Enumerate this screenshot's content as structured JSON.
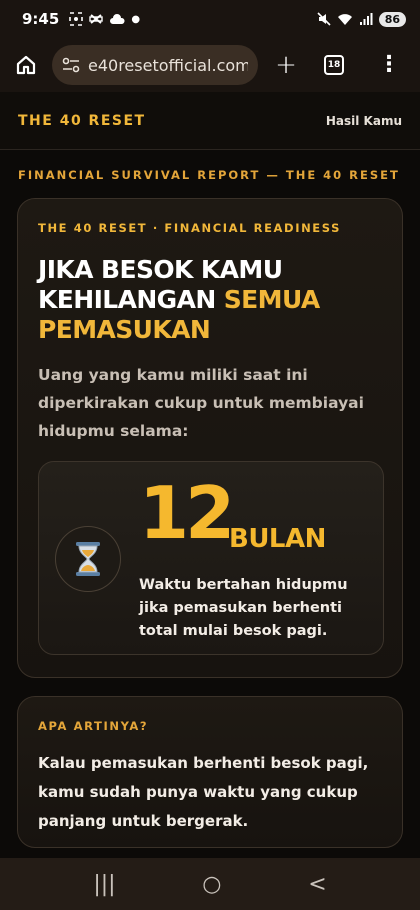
{
  "status_bar": {
    "time": "9:45",
    "battery": "86"
  },
  "browser": {
    "url": "e40resetofficial.com",
    "tab_count": "18",
    "plus": "+",
    "menu": "⋮"
  },
  "site_header": {
    "brand": "THE 40 RESET",
    "link": "Hasil Kamu"
  },
  "eyebrow": "FINANCIAL SURVIVAL REPORT — THE 40 RESET",
  "main_card": {
    "label": "THE 40 RESET · FINANCIAL READINESS",
    "headline_part1": "Jika besok kamu kehilangan",
    "headline_accent": "semua pemasukan",
    "intro": "Uang yang kamu miliki saat ini diperkirakan cukup untuk membiayai hidupmu selama:",
    "months_value": "12",
    "months_unit": "BULAN",
    "duration_desc": "Waktu bertahan hidupmu jika pemasukan berhenti total mulai besok pagi."
  },
  "meaning_card": {
    "label": "APA ARTINYA?",
    "text": "Kalau pemasukan berhenti besok pagi, kamu sudah punya waktu yang cukup panjang untuk bergerak."
  },
  "nav": {
    "recents": "|||",
    "home": "○",
    "back": "<"
  }
}
